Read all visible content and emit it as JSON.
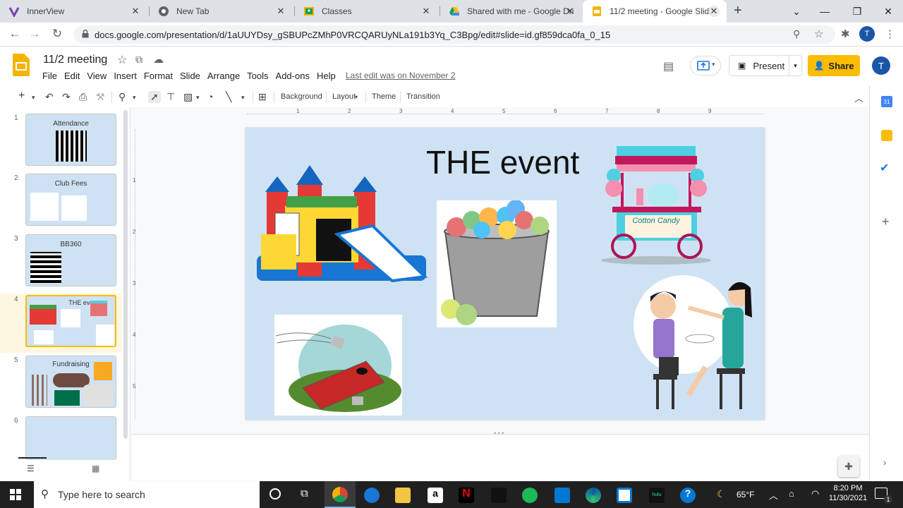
{
  "browser": {
    "tabs": [
      {
        "title": "InnerView",
        "icon": "innerview-icon"
      },
      {
        "title": "New Tab",
        "icon": "chrome-icon"
      },
      {
        "title": "Classes",
        "icon": "classroom-icon"
      },
      {
        "title": "Shared with me - Google Dri",
        "icon": "drive-icon"
      },
      {
        "title": "11/2 meeting - Google Slide",
        "icon": "slides-icon",
        "active": true
      }
    ],
    "url": "docs.google.com/presentation/d/1aUUYDsy_gSBUPcZMhP0VRCQARUyNLa191b3Yq_C3Bpg/edit#slide=id.gf859dca0fa_0_15"
  },
  "app": {
    "title": "11/2 meeting",
    "menu": [
      "File",
      "Edit",
      "View",
      "Insert",
      "Format",
      "Slide",
      "Arrange",
      "Tools",
      "Add-ons",
      "Help"
    ],
    "last_edit": "Last edit was on November 2",
    "present_label": "Present",
    "share_label": "Share",
    "avatar_letter": "T"
  },
  "toolbar": {
    "background": "Background",
    "layout": "Layout",
    "theme": "Theme",
    "transition": "Transition"
  },
  "slides": [
    {
      "num": "1",
      "title": "Attendance"
    },
    {
      "num": "2",
      "title": "Club Fees"
    },
    {
      "num": "3",
      "title": "BB360"
    },
    {
      "num": "4",
      "title": "THE event",
      "selected": true
    },
    {
      "num": "5",
      "title": "Fundraising"
    },
    {
      "num": "6",
      "title": ""
    }
  ],
  "ruler": {
    "h": [
      "1",
      "2",
      "3",
      "4",
      "5",
      "6",
      "7",
      "8",
      "9"
    ],
    "v": [
      "1",
      "2",
      "3",
      "4",
      "5"
    ]
  },
  "current_slide": {
    "title": "THE event",
    "cart_sign": "Cotton Candy"
  },
  "taskbar": {
    "search_placeholder": "Type here to search",
    "temperature": "65°F",
    "time": "8:20 PM",
    "date": "11/30/2021",
    "notifications": "1"
  },
  "colors": {
    "slide_bg": "#cfe2f3",
    "share_yellow": "#fbbc04",
    "accent_blue": "#1a73e8"
  }
}
